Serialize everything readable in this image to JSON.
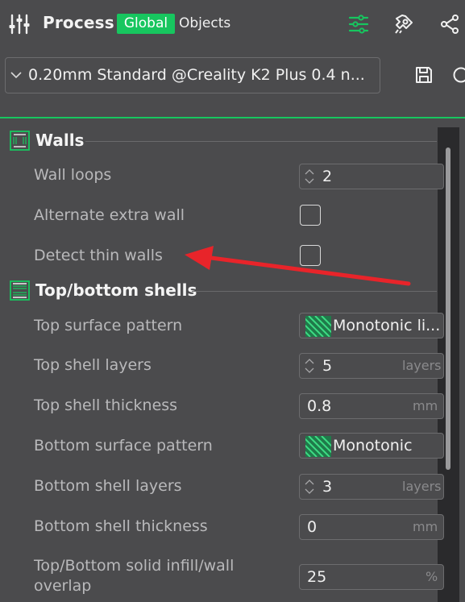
{
  "header": {
    "title": "Process",
    "tabs": [
      {
        "label": "Global",
        "active": true
      },
      {
        "label": "Objects",
        "active": false
      }
    ],
    "icons": [
      "process-sliders-icon",
      "parameter-list-icon",
      "advanced-settings-icon",
      "compare-share-icon"
    ]
  },
  "preset": {
    "name": "0.20mm Standard @Creality K2 Plus 0.4 n...",
    "icons": [
      "chevron-down-icon",
      "save-icon",
      "compare-icon"
    ]
  },
  "accent_color": "#17c65f",
  "sections": [
    {
      "title": "Walls",
      "icon": "walls-icon",
      "rows": [
        {
          "label": "Wall loops",
          "type": "spin",
          "value": "2",
          "unit": ""
        },
        {
          "label": "Alternate extra wall",
          "type": "checkbox",
          "checked": false
        },
        {
          "label": "Detect thin walls",
          "type": "checkbox",
          "checked": false
        }
      ]
    },
    {
      "title": "Top/bottom shells",
      "icon": "shells-icon",
      "rows": [
        {
          "label": "Top surface pattern",
          "type": "pattern",
          "value": "Monotonic li..."
        },
        {
          "label": "Top shell layers",
          "type": "spin",
          "value": "5",
          "unit": "layers"
        },
        {
          "label": "Top shell thickness",
          "type": "text",
          "value": "0.8",
          "unit": "mm"
        },
        {
          "label": "Bottom surface pattern",
          "type": "pattern",
          "value": "Monotonic"
        },
        {
          "label": "Bottom shell layers",
          "type": "spin",
          "value": "3",
          "unit": "layers"
        },
        {
          "label": "Bottom shell thickness",
          "type": "text",
          "value": "0",
          "unit": "mm"
        },
        {
          "label_line1": "Top/Bottom solid infill/wall",
          "label_line2": "overlap",
          "type": "text",
          "value": "25",
          "unit": "%"
        }
      ]
    }
  ],
  "annotation": {
    "type": "red-arrow",
    "color": "#e8242a",
    "points_to": "Detect thin walls"
  }
}
